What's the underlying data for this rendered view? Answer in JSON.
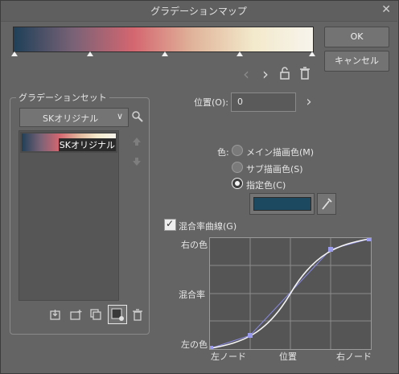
{
  "window": {
    "title": "グラデーションマップ",
    "close_glyph": "✕"
  },
  "gradient": {
    "colors": [
      "#1e4058",
      "#7a6276",
      "#d46670",
      "#e0b49a",
      "#f3e9cb",
      "#f7f4ec"
    ],
    "nav_prev": "‹",
    "nav_next": "›",
    "lock_icon": "lock-icon",
    "delete_icon": "trash-icon"
  },
  "buttons": {
    "ok": "OK",
    "cancel": "キャンセル"
  },
  "gradient_set": {
    "group_label": "グラデーションセット",
    "selected_set": "SKオリジナル",
    "dropdown_arrow": "∨",
    "items": [
      {
        "label": "SKオリジナル"
      }
    ]
  },
  "position": {
    "label": "位置(O):",
    "value": "0",
    "arrow": "›"
  },
  "color": {
    "label": "色:",
    "options": [
      {
        "label": "メイン描画色(M)",
        "checked": false
      },
      {
        "label": "サブ描画色(S)",
        "checked": false
      },
      {
        "label": "指定色(C)",
        "checked": true
      }
    ],
    "swatch": "#1c4860"
  },
  "blend_curve": {
    "label": "混合率曲線(G)",
    "checked": true,
    "check_glyph": "✓",
    "y_top": "右の色",
    "y_mid": "混合率",
    "y_bottom": "左の色",
    "x_left": "左ノード",
    "x_mid": "位置",
    "x_right": "右ノード"
  }
}
